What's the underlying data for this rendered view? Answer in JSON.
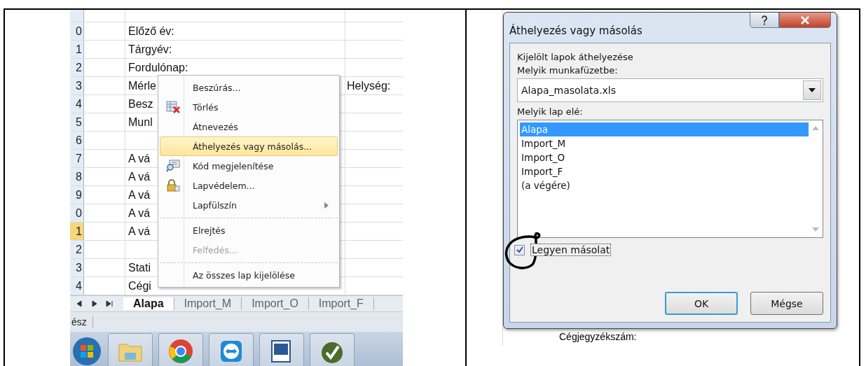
{
  "spreadsheet": {
    "rows": [
      {
        "header": "",
        "text": "",
        "text_right": "",
        "selected": false
      },
      {
        "header": "0",
        "text": "Előző év:",
        "text_right": "",
        "selected": false
      },
      {
        "header": "1",
        "text": "Tárgyév:",
        "text_right": "",
        "selected": false
      },
      {
        "header": "2",
        "text": "Fordulónap:",
        "text_right": "",
        "selected": false
      },
      {
        "header": "3",
        "text": "Mérle",
        "text_right": "Helység:",
        "selected": false
      },
      {
        "header": "4",
        "text": "Besz",
        "text_right": "",
        "selected": false
      },
      {
        "header": "5",
        "text": "Munl",
        "text_right": "",
        "selected": false
      },
      {
        "header": "6",
        "text": "",
        "text_right": "",
        "selected": false
      },
      {
        "header": "7",
        "text": "A vá",
        "text_right": "",
        "selected": false
      },
      {
        "header": "8",
        "text": "A vá",
        "text_right": "",
        "selected": false
      },
      {
        "header": "9",
        "text": "A vá",
        "text_right": "",
        "selected": false
      },
      {
        "header": "0",
        "text": "A vá",
        "text_right": "",
        "selected": false
      },
      {
        "header": "1",
        "text": "A vá",
        "text_right": "",
        "selected": true
      },
      {
        "header": "2",
        "text": "",
        "text_right": "",
        "selected": false
      },
      {
        "header": "3",
        "text": "Stati",
        "text_right": "",
        "selected": false
      },
      {
        "header": "4",
        "text": "Cégi",
        "text_right": "",
        "selected": false
      }
    ],
    "sheet_tabs": [
      {
        "label": "Alapa",
        "selected": true
      },
      {
        "label": "Import_M",
        "selected": false
      },
      {
        "label": "Import_O",
        "selected": false
      },
      {
        "label": "Import_F",
        "selected": false
      }
    ],
    "status_bar": {
      "text": "ész"
    }
  },
  "context_menu": {
    "items": [
      {
        "label": "Beszúrás...",
        "kind": "plain",
        "highlighted": false,
        "disabled": false,
        "submenu": false,
        "separator_before": false
      },
      {
        "label": "Törlés",
        "kind": "delete",
        "highlighted": false,
        "disabled": false,
        "submenu": false,
        "separator_before": false
      },
      {
        "label": "Átnevezés",
        "kind": "plain",
        "highlighted": false,
        "disabled": false,
        "submenu": false,
        "separator_before": false
      },
      {
        "label": "Áthelyezés vagy másolás...",
        "kind": "plain",
        "highlighted": true,
        "disabled": false,
        "submenu": false,
        "separator_before": false
      },
      {
        "label": "Kód megjelenítése",
        "kind": "code",
        "highlighted": false,
        "disabled": false,
        "submenu": false,
        "separator_before": false
      },
      {
        "label": "Lapvédelem...",
        "kind": "lock",
        "highlighted": false,
        "disabled": false,
        "submenu": false,
        "separator_before": false
      },
      {
        "label": "Lapfülszín",
        "kind": "plain",
        "highlighted": false,
        "disabled": false,
        "submenu": true,
        "separator_before": false
      },
      {
        "label": "Elrejtés",
        "kind": "plain",
        "highlighted": false,
        "disabled": false,
        "submenu": false,
        "separator_before": true
      },
      {
        "label": "Felfedés...",
        "kind": "plain",
        "highlighted": false,
        "disabled": true,
        "submenu": false,
        "separator_before": false
      },
      {
        "label": "Az összes lap kijelölése",
        "kind": "plain",
        "highlighted": false,
        "disabled": false,
        "submenu": false,
        "separator_before": true
      }
    ]
  },
  "dialog": {
    "title": "Áthelyezés vagy másolás",
    "intro": "Kijelölt lapok áthelyezése",
    "workbook_label": "Melyik munkafüzetbe:",
    "workbook_value": "Alapa_masolata.xls",
    "sheet_label": "Melyik lap elé:",
    "sheets": [
      {
        "label": "Alapa",
        "selected": true
      },
      {
        "label": "Import_M",
        "selected": false
      },
      {
        "label": "Import_O",
        "selected": false
      },
      {
        "label": "Import_F",
        "selected": false
      },
      {
        "label": "(a végére)",
        "selected": false
      }
    ],
    "copy_checkbox": {
      "label": "Legyen másolat",
      "checked": true
    },
    "buttons": [
      {
        "label": "OK",
        "default": true
      },
      {
        "label": "Mégse",
        "default": false
      }
    ],
    "background_text": "Cégjegyzékszám:"
  }
}
